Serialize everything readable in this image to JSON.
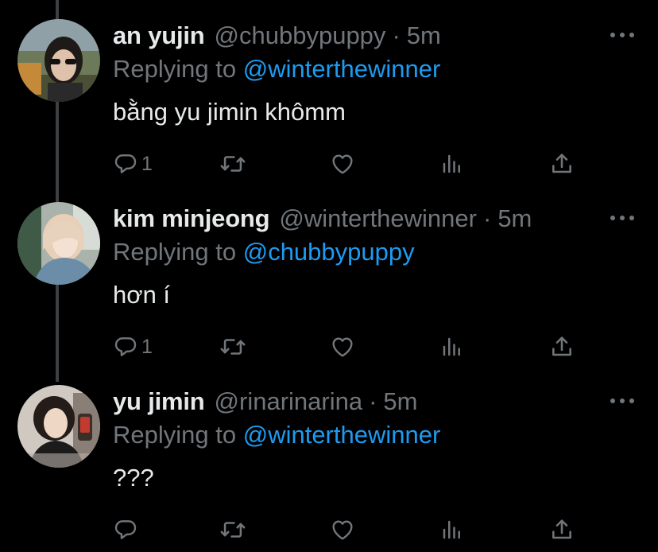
{
  "thread": {
    "tweets": [
      {
        "display_name": "an yujin",
        "handle": "@chubbypuppy",
        "separator": "·",
        "time": "5m",
        "replying_prefix": "Replying to",
        "replying_to": "@winterthewinner",
        "text": "bằng yu jimin khômm",
        "reply_count": "1",
        "avatar": "avatar-an-yujin"
      },
      {
        "display_name": "kim minjeong",
        "handle": "@winterthewinner",
        "separator": "·",
        "time": "5m",
        "replying_prefix": "Replying to",
        "replying_to": "@chubbypuppy",
        "text": "hơn í",
        "reply_count": "1",
        "avatar": "avatar-kim-minjeong"
      },
      {
        "display_name": "yu jimin",
        "handle": "@rinarinarina",
        "separator": "·",
        "time": "5m",
        "replying_prefix": "Replying to",
        "replying_to": "@winterthewinner",
        "text": "???",
        "reply_count": "",
        "avatar": "avatar-yu-jimin"
      }
    ]
  },
  "icons": {
    "reply": "reply-icon",
    "retweet": "retweet-icon",
    "like": "heart-icon",
    "views": "views-icon",
    "share": "share-icon",
    "more": "more-icon"
  },
  "colors": {
    "background": "#000000",
    "text": "#e7e9ea",
    "secondary": "#71767b",
    "link": "#1d9bf0",
    "thread_line": "#3e4144"
  }
}
